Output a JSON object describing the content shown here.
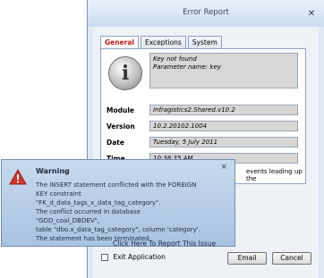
{
  "window": {
    "title": "Error Report",
    "close_glyph": "✕"
  },
  "tabs": [
    {
      "label": "General",
      "active": true
    },
    {
      "label": "Exceptions",
      "active": false
    },
    {
      "label": "System",
      "active": false
    }
  ],
  "general": {
    "message_lines": [
      "Key not found",
      "Parameter name: key"
    ],
    "fields": [
      {
        "label": "Module",
        "value": "Infragistics2.Shared.v10.2"
      },
      {
        "label": "Version",
        "value": "10.2.20102.1004"
      },
      {
        "label": "Date",
        "value": "Tuesday, 5 July 2011"
      },
      {
        "label": "Time",
        "value": "10:38:35 AM"
      }
    ],
    "events_fragment": "events leading up the",
    "exit_label": "Exit Application",
    "exit_checked": false
  },
  "buttons": {
    "email": "Email",
    "cancel": "Cancel"
  },
  "toast": {
    "title": "Warning",
    "close_glyph": "×",
    "body_lines": [
      "The INSERT statement conflicted with the FOREIGN",
      "KEY constraint \"FK_d_data_tags_x_data_tag_category\".",
      "The conflict occurred in database \"GDD_coal_DBDEV\",",
      "table \"dbo.x_data_tag_category\", column 'category'.",
      "The statement has been terminated."
    ],
    "link": "Click Here To Report This Issue"
  },
  "colors": {
    "active_tab": "#c01818",
    "warning": "#d9342b",
    "toast_bg": "#b8cfea"
  }
}
